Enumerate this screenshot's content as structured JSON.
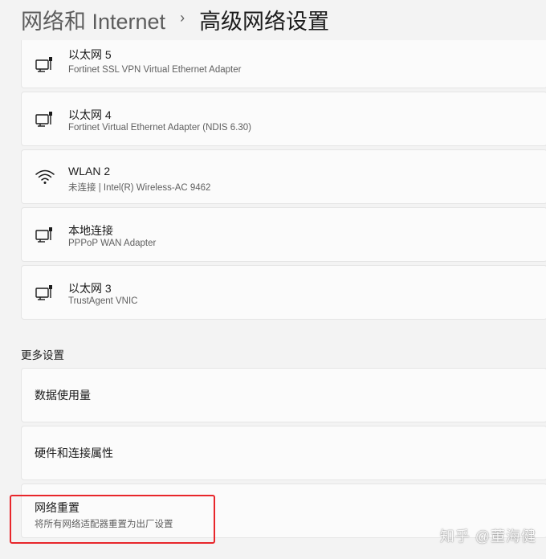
{
  "header": {
    "parent": "网络和 Internet",
    "separator": "›",
    "current": "高级网络设置"
  },
  "adapters": [
    {
      "name": "以太网 5",
      "description": "Fortinet SSL VPN Virtual Ethernet Adapter",
      "icon": "ethernet-icon"
    },
    {
      "name": "以太网 4",
      "description": "Fortinet Virtual Ethernet Adapter (NDIS 6.30)",
      "icon": "ethernet-icon"
    },
    {
      "name": "WLAN 2",
      "description": "未连接 | Intel(R) Wireless-AC 9462",
      "icon": "wifi-icon"
    },
    {
      "name": "本地连接",
      "description": "PPPoP WAN Adapter",
      "icon": "ethernet-icon"
    },
    {
      "name": "以太网 3",
      "description": "TrustAgent VNIC",
      "icon": "ethernet-icon"
    }
  ],
  "more_settings": {
    "title": "更多设置",
    "items": [
      {
        "label": "数据使用量"
      },
      {
        "label": "硬件和连接属性"
      },
      {
        "label": "网络重置",
        "description": "将所有网络适配器重置为出厂设置"
      }
    ]
  },
  "annotation": {
    "color": "#e8262b"
  },
  "watermark": "知乎 @董海健"
}
